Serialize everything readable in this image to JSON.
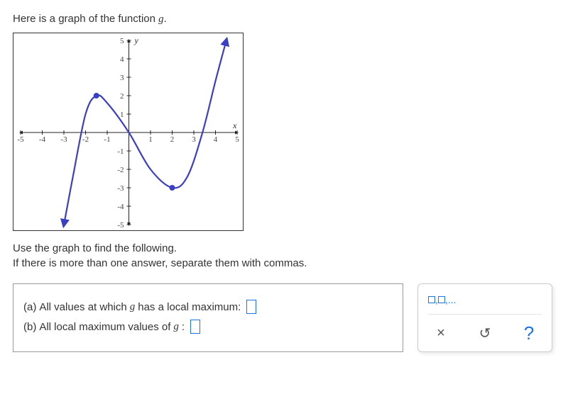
{
  "prompt": {
    "line1_a": "Here is a graph of the function ",
    "line1_g": "g",
    "line1_b": "."
  },
  "instructions": {
    "l1": "Use the graph to find the following.",
    "l2": "If there is more than one answer, separate them with commas."
  },
  "questions": {
    "a_prefix": "(a) ",
    "a_text1": "All values at which ",
    "a_g": "g",
    "a_text2": " has a local maximum:",
    "b_prefix": "(b) ",
    "b_text1": "All local maximum values of ",
    "b_g": "g",
    "b_text2": " :"
  },
  "tools": {
    "list_hint_sep": ",",
    "list_hint_tail": ",...",
    "clear": "×",
    "reset": "↺",
    "help": "?"
  },
  "chart_data": {
    "type": "line",
    "title": "",
    "xlabel": "x",
    "ylabel": "y",
    "xlim": [
      -5,
      5
    ],
    "ylim": [
      -5,
      5
    ],
    "x_ticks": [
      -5,
      -4,
      -3,
      -2,
      -1,
      1,
      2,
      3,
      4,
      5
    ],
    "y_ticks": [
      -5,
      -4,
      -3,
      -2,
      -1,
      1,
      2,
      3,
      4,
      5
    ],
    "series": [
      {
        "name": "g",
        "points": [
          [
            -3,
            -5
          ],
          [
            -2.6,
            -2.5
          ],
          [
            -2,
            1
          ],
          [
            -1.5,
            2
          ],
          [
            -1,
            1.6
          ],
          [
            0,
            0
          ],
          [
            1,
            -2
          ],
          [
            2,
            -3
          ],
          [
            2.7,
            -2.4
          ],
          [
            3.4,
            0
          ],
          [
            4,
            2.8
          ],
          [
            4.5,
            5
          ]
        ],
        "left_end": "arrow",
        "right_end": "arrow",
        "marked_points": [
          [
            -1.5,
            2
          ],
          [
            2,
            -3
          ]
        ]
      }
    ],
    "local_maximum_x": [
      -1.5
    ],
    "local_maximum_values": [
      2
    ]
  }
}
